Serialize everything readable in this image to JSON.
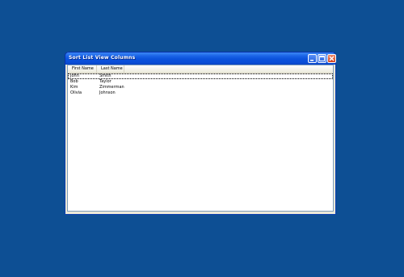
{
  "window": {
    "title": "Sort List View Columns",
    "controls": {
      "minimize_icon": "minimize-icon",
      "maximize_icon": "maximize-icon",
      "close_icon": "close-icon"
    }
  },
  "listview": {
    "columns": [
      {
        "label": "First Name"
      },
      {
        "label": "Last Name"
      }
    ],
    "rows": [
      {
        "first": "John",
        "last": "Smith",
        "focused": true
      },
      {
        "first": "Bob",
        "last": "Taylor"
      },
      {
        "first": "Kim",
        "last": "Zimmerman"
      },
      {
        "first": "Olivia",
        "last": "Johnson"
      }
    ]
  },
  "colors": {
    "desktop": "#0d4f94",
    "titlebar": "#0b52dc",
    "close_button": "#d2401c"
  }
}
